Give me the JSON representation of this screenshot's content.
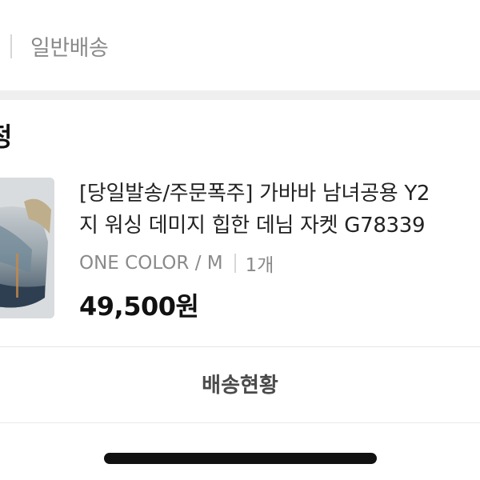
{
  "order": {
    "shipping_type": "일반배송",
    "section_title": "정"
  },
  "product": {
    "name_line1": "[당일발송/주문폭주] 가바바 남녀공용 Y2",
    "name_line2": "지 워싱 데미지 힙한 데님 자켓 G78339",
    "option": "ONE COLOR / M",
    "quantity": "1개",
    "price": "49,500원"
  },
  "actions": {
    "track_label": "배송현황"
  }
}
